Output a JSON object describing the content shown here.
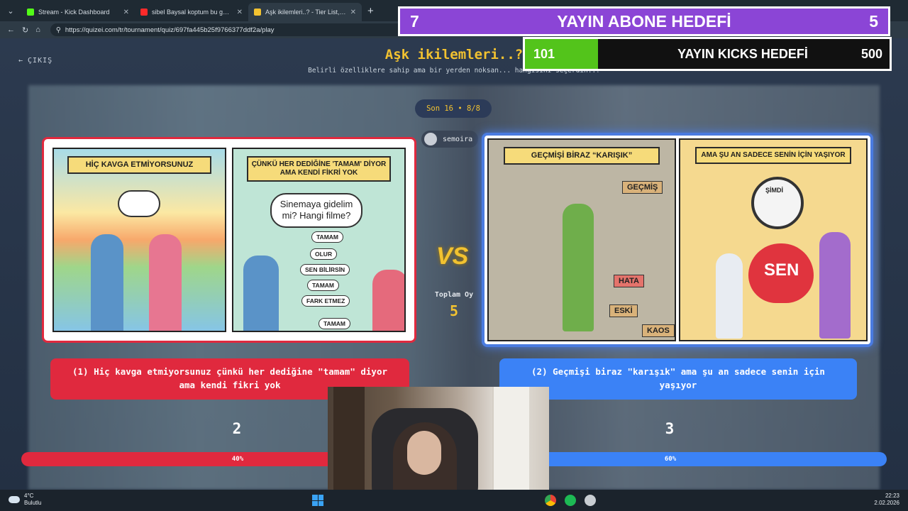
{
  "browser": {
    "tabs": [
      {
        "title": "Stream - Kick Dashboard",
        "color": "#53fc18",
        "active": false
      },
      {
        "title": "sibel Baysal koptum bu gece - You",
        "color": "#ff2a2a",
        "active": false
      },
      {
        "title": "Aşk ikilemleri..? - Tier List, Kör Sıral",
        "color": "#f2c230",
        "active": true
      }
    ],
    "url": "https://quizei.com/tr/tournament/quiz/697fa445b25f9766377ddf2a/play"
  },
  "page": {
    "exit_label": "ÇIKIŞ",
    "title": "Aşk ikilemleri..?",
    "subtitle": "Belirli özelliklere sahip ama bir yerden noksan... hangisini seçerdin..?",
    "round": "Son 16 • 8/8",
    "user": "semoira"
  },
  "left": {
    "panel1_banner": "HİÇ KAVGA ETMİYORSUNUZ",
    "panel2_banner": "ÇÜNKÜ HER DEDİĞİNE 'TAMAM' DİYOR AMA KENDİ FİKRİ YOK",
    "bubble": "Sinemaya gidelim mi? Hangi filme?",
    "tags": [
      "TAMAM",
      "OLUR",
      "SEN BİLİRSİN",
      "TAMAM",
      "FARK ETMEZ",
      "TAMAM"
    ],
    "caption": "(1) Hiç kavga etmiyorsunuz çünkü her dediğine \"tamam\" diyor ama kendi fikri yok",
    "votes": "2",
    "percent": "40%",
    "color": "#e0293e"
  },
  "right": {
    "panel1_banner": "GEÇMİŞİ BİRAZ “KARIŞIK”",
    "panel2_banner": "AMA ŞU AN SADECE SENİN İÇİN YAŞIYOR",
    "signs": [
      "GEÇMİŞ",
      "HATA",
      "ESKİ",
      "KAOS"
    ],
    "clock_label": "ŞİMDİ",
    "heart_label": "SEN",
    "caption": "(2) Geçmişi biraz \"karışık\" ama şu an sadece senin için yaşıyor",
    "votes": "3",
    "percent": "60%",
    "color": "#3b82f6"
  },
  "vs_label": "VS",
  "total": {
    "label": "Toplam Oy",
    "value": "5"
  },
  "overlay": {
    "sub_goal": {
      "current": "7",
      "title": "YAYIN ABONE HEDEFİ",
      "target": "5"
    },
    "kick_goal": {
      "current": "101",
      "title": "YAYIN KICKS HEDEFİ",
      "target": "500",
      "progress": 0.2
    }
  },
  "taskbar": {
    "temp": "4°C",
    "weather": "Bulutlu",
    "time": "22:23",
    "date": "2.02.2026"
  }
}
